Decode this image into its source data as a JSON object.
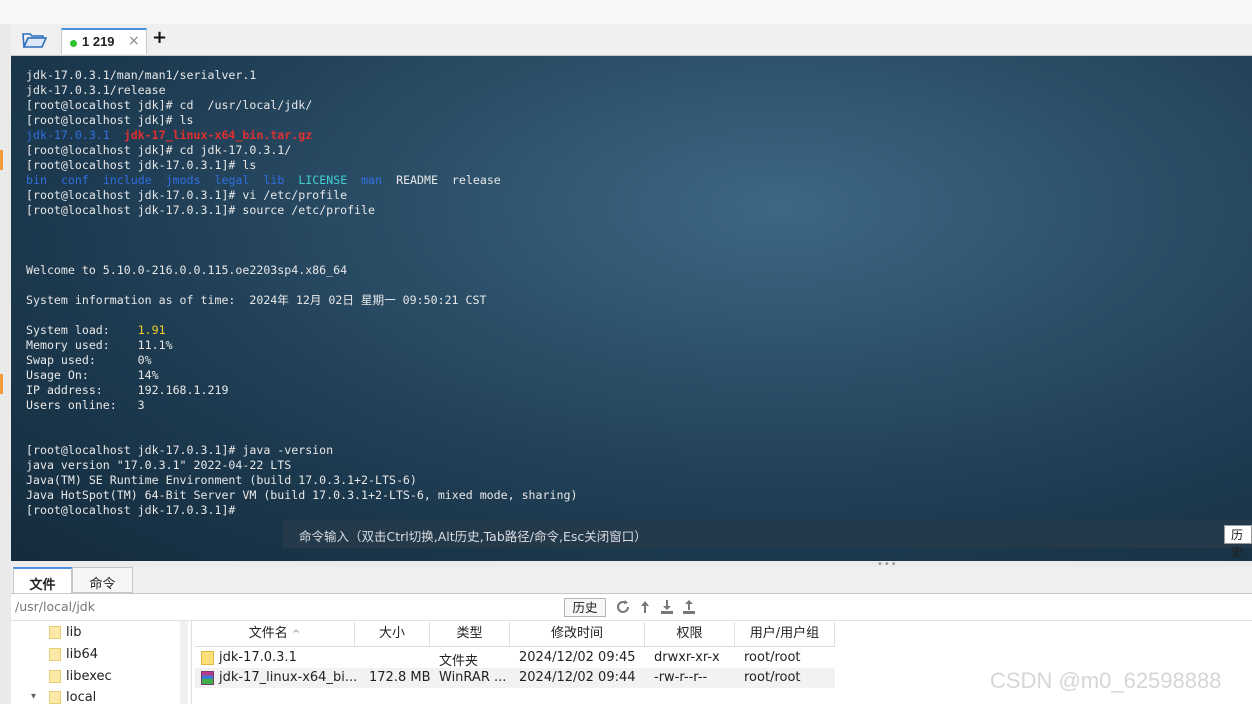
{
  "tabs": {
    "session_label": "1 219",
    "close_glyph": "×",
    "add_glyph": "+"
  },
  "terminal": {
    "lines": [
      [
        {
          "t": "jdk-17.0.3.1/man/man1/serialver.1",
          "c": ""
        }
      ],
      [
        {
          "t": "jdk-17.0.3.1/release",
          "c": ""
        }
      ],
      [
        {
          "t": "[root@localhost jdk]# cd  /usr/local/jdk/",
          "c": ""
        }
      ],
      [
        {
          "t": "[root@localhost jdk]# ls",
          "c": ""
        }
      ],
      [
        {
          "t": "jdk-17.0.3.1",
          "c": "c-blue"
        },
        {
          "t": "  ",
          "c": ""
        },
        {
          "t": "jdk-17_linux-x64_bin.tar.gz",
          "c": "c-red"
        }
      ],
      [
        {
          "t": "[root@localhost jdk]# cd jdk-17.0.3.1/",
          "c": ""
        }
      ],
      [
        {
          "t": "[root@localhost jdk-17.0.3.1]# ls",
          "c": ""
        }
      ],
      [
        {
          "t": "bin",
          "c": "c-blue"
        },
        {
          "t": "  ",
          "c": ""
        },
        {
          "t": "conf",
          "c": "c-blue"
        },
        {
          "t": "  ",
          "c": ""
        },
        {
          "t": "include",
          "c": "c-blue"
        },
        {
          "t": "  ",
          "c": ""
        },
        {
          "t": "jmods",
          "c": "c-blue"
        },
        {
          "t": "  ",
          "c": ""
        },
        {
          "t": "legal",
          "c": "c-blue"
        },
        {
          "t": "  ",
          "c": ""
        },
        {
          "t": "lib",
          "c": "c-blue"
        },
        {
          "t": "  ",
          "c": ""
        },
        {
          "t": "LICENSE",
          "c": "c-green"
        },
        {
          "t": "  ",
          "c": ""
        },
        {
          "t": "man",
          "c": "c-blue"
        },
        {
          "t": "  README  release",
          "c": ""
        }
      ],
      [
        {
          "t": "[root@localhost jdk-17.0.3.1]# vi /etc/profile",
          "c": ""
        }
      ],
      [
        {
          "t": "[root@localhost jdk-17.0.3.1]# source /etc/profile",
          "c": ""
        }
      ],
      [
        {
          "t": "",
          "c": ""
        }
      ],
      [
        {
          "t": "",
          "c": ""
        }
      ],
      [
        {
          "t": "",
          "c": ""
        }
      ],
      [
        {
          "t": "Welcome to 5.10.0-216.0.0.115.oe2203sp4.x86_64",
          "c": ""
        }
      ],
      [
        {
          "t": "",
          "c": ""
        }
      ],
      [
        {
          "t": "System information as of time:  2024年 12月 02日 星期一 09:50:21 CST",
          "c": ""
        }
      ],
      [
        {
          "t": "",
          "c": ""
        }
      ],
      [
        {
          "t": "System load:    ",
          "c": ""
        },
        {
          "t": "1.91",
          "c": "c-yellow"
        }
      ],
      [
        {
          "t": "Memory used:    11.1%",
          "c": ""
        }
      ],
      [
        {
          "t": "Swap used:      0%",
          "c": ""
        }
      ],
      [
        {
          "t": "Usage On:       14%",
          "c": ""
        }
      ],
      [
        {
          "t": "IP address:     192.168.1.219",
          "c": ""
        }
      ],
      [
        {
          "t": "Users online:   3",
          "c": ""
        }
      ],
      [
        {
          "t": "",
          "c": ""
        }
      ],
      [
        {
          "t": "",
          "c": ""
        }
      ],
      [
        {
          "t": "[root@localhost jdk-17.0.3.1]# java -version",
          "c": ""
        }
      ],
      [
        {
          "t": "java version \"17.0.3.1\" 2022-04-22 LTS",
          "c": ""
        }
      ],
      [
        {
          "t": "Java(TM) SE Runtime Environment (build 17.0.3.1+2-LTS-6)",
          "c": ""
        }
      ],
      [
        {
          "t": "Java HotSpot(TM) 64-Bit Server VM (build 17.0.3.1+2-LTS-6, mixed mode, sharing)",
          "c": ""
        }
      ],
      [
        {
          "t": "[root@localhost jdk-17.0.3.1]# ",
          "c": ""
        }
      ]
    ]
  },
  "cmdbar": {
    "hint": "命令输入（双击Ctrl切换,Alt历史,Tab路径/命令,Esc关闭窗口）",
    "history_button": "历史"
  },
  "panel": {
    "tab_files": "文件",
    "tab_commands": "命令",
    "path": "/usr/local/jdk",
    "history_button": "历史",
    "toolbar_icons": [
      "refresh-icon",
      "up-dir-icon",
      "download-icon",
      "upload-icon"
    ]
  },
  "tree": {
    "nodes": [
      "lib",
      "lib64",
      "libexec",
      "local"
    ]
  },
  "files": {
    "columns": [
      "文件名",
      "大小",
      "类型",
      "修改时间",
      "权限",
      "用户/用户组"
    ],
    "sort_glyph": "^",
    "rows": [
      {
        "name": "jdk-17.0.3.1",
        "size": "",
        "type": "文件夹",
        "mtime": "2024/12/02 09:45",
        "perm": "drwxr-xr-x",
        "owner": "root/root",
        "icon": "folder-icon"
      },
      {
        "name": "jdk-17_linux-x64_bi...",
        "size": "172.8 MB",
        "type": "WinRAR ...",
        "mtime": "2024/12/02 09:44",
        "perm": "-rw-r--r--",
        "owner": "root/root",
        "icon": "archive-icon"
      }
    ]
  },
  "watermark": "CSDN @m0_62598888",
  "colors": {
    "accent": "#4a90e2",
    "status_green": "#2ec12e",
    "term_blue": "#2f6fe0",
    "term_red": "#e03030",
    "term_yellow": "#f0d020",
    "term_cyan": "#41d0d0"
  }
}
